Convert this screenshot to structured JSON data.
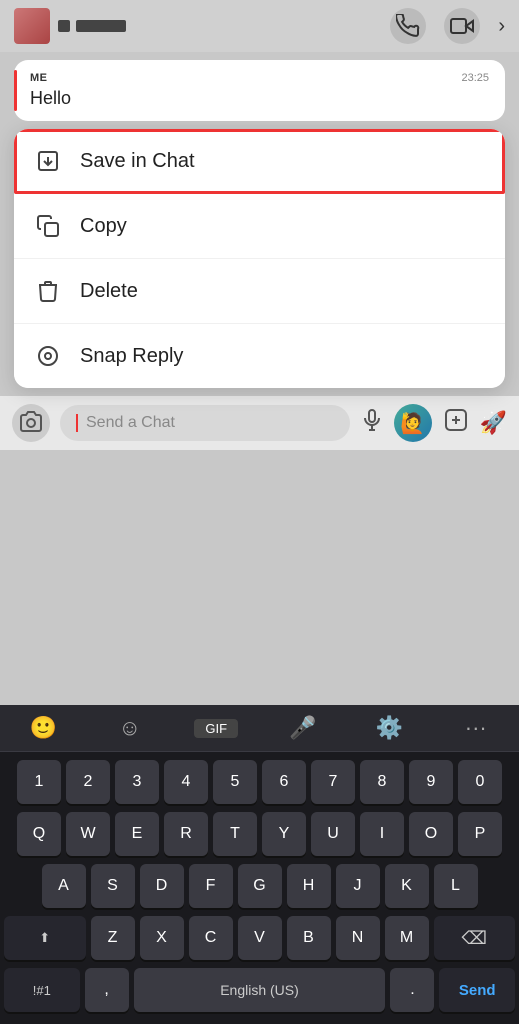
{
  "topBar": {
    "callIcon": "📞",
    "videoIcon": "📷",
    "chevronIcon": "›"
  },
  "message": {
    "sender": "ME",
    "time": "23:25",
    "text": "Hello"
  },
  "contextMenu": {
    "items": [
      {
        "id": "save-in-chat",
        "label": "Save in Chat",
        "highlighted": true
      },
      {
        "id": "copy",
        "label": "Copy",
        "highlighted": false
      },
      {
        "id": "delete",
        "label": "Delete",
        "highlighted": false
      },
      {
        "id": "snap-reply",
        "label": "Snap Reply",
        "highlighted": false
      }
    ]
  },
  "inputBar": {
    "placeholder": "Send a Chat"
  },
  "keyboard": {
    "toolbarIcons": [
      "😊",
      "😀",
      "GIF",
      "🎙️",
      "⚙️",
      "···"
    ],
    "row1": [
      "1",
      "2",
      "3",
      "4",
      "5",
      "6",
      "7",
      "8",
      "9",
      "0"
    ],
    "row2": [
      "Q",
      "W",
      "E",
      "R",
      "T",
      "Y",
      "U",
      "I",
      "O",
      "P"
    ],
    "row3": [
      "A",
      "S",
      "D",
      "F",
      "G",
      "H",
      "J",
      "K",
      "L"
    ],
    "row4": [
      "Z",
      "X",
      "C",
      "V",
      "B",
      "N",
      "M"
    ],
    "spaceLabel": "English (US)",
    "sendLabel": "Send",
    "symLabel": "!#1"
  }
}
